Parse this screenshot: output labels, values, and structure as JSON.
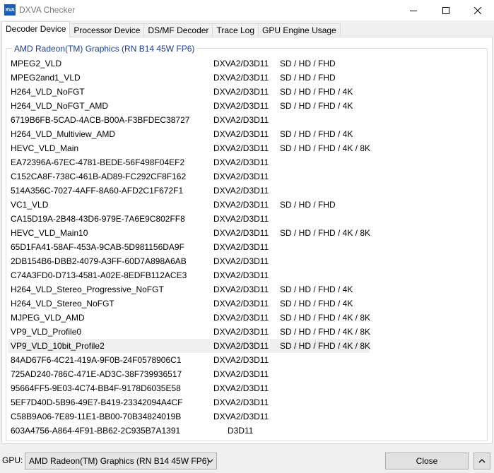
{
  "window": {
    "title": "DXVA Checker",
    "icon_text": "XVA",
    "icon_name": "dxva-app-icon"
  },
  "tabs": [
    {
      "label": "Decoder Device",
      "active": true
    },
    {
      "label": "Processor Device",
      "active": false
    },
    {
      "label": "DS/MF Decoder",
      "active": false
    },
    {
      "label": "Trace Log",
      "active": false
    },
    {
      "label": "GPU Engine Usage",
      "active": false
    }
  ],
  "group_title": "AMD Radeon(TM) Graphics (RN B14 45W FP6)",
  "decoders": [
    {
      "name": "MPEG2_VLD",
      "api": "DXVA2/D3D11",
      "res": "SD / HD / FHD"
    },
    {
      "name": "MPEG2and1_VLD",
      "api": "DXVA2/D3D11",
      "res": "SD / HD / FHD"
    },
    {
      "name": "H264_VLD_NoFGT",
      "api": "DXVA2/D3D11",
      "res": "SD / HD / FHD / 4K"
    },
    {
      "name": "H264_VLD_NoFGT_AMD",
      "api": "DXVA2/D3D11",
      "res": "SD / HD / FHD / 4K"
    },
    {
      "name": "6719B6FB-5CAD-4ACB-B00A-F3BFDEC38727",
      "api": "DXVA2/D3D11",
      "res": ""
    },
    {
      "name": "H264_VLD_Multiview_AMD",
      "api": "DXVA2/D3D11",
      "res": "SD / HD / FHD / 4K"
    },
    {
      "name": "HEVC_VLD_Main",
      "api": "DXVA2/D3D11",
      "res": "SD / HD / FHD / 4K / 8K"
    },
    {
      "name": "EA72396A-67EC-4781-BEDE-56F498F04EF2",
      "api": "DXVA2/D3D11",
      "res": ""
    },
    {
      "name": "C152CA8F-738C-461B-AD89-FC292CF8F162",
      "api": "DXVA2/D3D11",
      "res": ""
    },
    {
      "name": "514A356C-7027-4AFF-8A60-AFD2C1F672F1",
      "api": "DXVA2/D3D11",
      "res": ""
    },
    {
      "name": "VC1_VLD",
      "api": "DXVA2/D3D11",
      "res": "SD / HD / FHD"
    },
    {
      "name": "CA15D19A-2B48-43D6-979E-7A6E9C802FF8",
      "api": "DXVA2/D3D11",
      "res": ""
    },
    {
      "name": "HEVC_VLD_Main10",
      "api": "DXVA2/D3D11",
      "res": "SD / HD / FHD / 4K / 8K"
    },
    {
      "name": "65D1FA41-58AF-453A-9CAB-5D981156DA9F",
      "api": "DXVA2/D3D11",
      "res": ""
    },
    {
      "name": "2DB154B6-DBB2-4079-A3FF-60D7A898A6AB",
      "api": "DXVA2/D3D11",
      "res": ""
    },
    {
      "name": "C74A3FD0-D713-4581-A02E-8EDFB112ACE3",
      "api": "DXVA2/D3D11",
      "res": ""
    },
    {
      "name": "H264_VLD_Stereo_Progressive_NoFGT",
      "api": "DXVA2/D3D11",
      "res": "SD / HD / FHD / 4K"
    },
    {
      "name": "H264_VLD_Stereo_NoFGT",
      "api": "DXVA2/D3D11",
      "res": "SD / HD / FHD / 4K"
    },
    {
      "name": "MJPEG_VLD_AMD",
      "api": "DXVA2/D3D11",
      "res": "SD / HD / FHD / 4K / 8K"
    },
    {
      "name": "VP9_VLD_Profile0",
      "api": "DXVA2/D3D11",
      "res": "SD / HD / FHD / 4K / 8K"
    },
    {
      "name": "VP9_VLD_10bit_Profile2",
      "api": "DXVA2/D3D11",
      "res": "SD / HD / FHD / 4K / 8K",
      "selected": true
    },
    {
      "name": "84AD67F6-4C21-419A-9F0B-24F0578906C1",
      "api": "DXVA2/D3D11",
      "res": ""
    },
    {
      "name": "725AD240-786C-471E-AD3C-38F739936517",
      "api": "DXVA2/D3D11",
      "res": ""
    },
    {
      "name": "95664FF5-9E03-4C74-BB4F-9178D6035E58",
      "api": "DXVA2/D3D11",
      "res": ""
    },
    {
      "name": "5EF7D40D-5B96-49E7-B419-23342094A4CF",
      "api": "DXVA2/D3D11",
      "res": ""
    },
    {
      "name": "C58B9A06-7E89-11E1-BB00-70B34824019B",
      "api": "DXVA2/D3D11",
      "res": ""
    },
    {
      "name": "603A4756-A864-4F91-BB62-2C935B7A1391",
      "api": "D3D11",
      "res": ""
    }
  ],
  "footer": {
    "gpu_label": "GPU:",
    "gpu_selected": "AMD Radeon(TM) Graphics (RN B14 45W FP6)",
    "close_label": "Close"
  },
  "colors": {
    "group_title": "#1b3f8a",
    "selected_row": "#f0f0f0",
    "app_icon": "#1a5fb4"
  }
}
